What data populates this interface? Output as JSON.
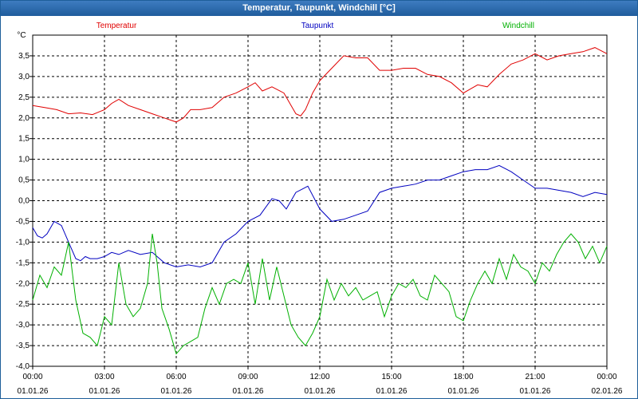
{
  "window": {
    "title": "Temperatur, Taupunkt, Windchill [°C]"
  },
  "chart_data": {
    "type": "line",
    "title": "Temperatur, Taupunkt, Windchill [°C]",
    "ylabel": "°C",
    "xlabel": "",
    "ylim": [
      -4.0,
      4.0
    ],
    "xlim": [
      0,
      24
    ],
    "yticks": [
      -4.0,
      -3.5,
      -3.0,
      -2.5,
      -2.0,
      -1.5,
      -1.0,
      -0.5,
      0.0,
      0.5,
      1.0,
      1.5,
      2.0,
      2.5,
      3.0,
      3.5
    ],
    "ytick_labels": [
      "-4,0",
      "-3,5",
      "-3,0",
      "-2,5",
      "-2,0",
      "-1,5",
      "-1,0",
      "-0,5",
      "0,0",
      "0,5",
      "1,0",
      "1,5",
      "2,0",
      "2,5",
      "3,0",
      "3,5"
    ],
    "xticks": [
      0,
      3,
      6,
      9,
      12,
      15,
      18,
      21,
      24
    ],
    "xtick_time_labels": [
      "00:00",
      "03:00",
      "06:00",
      "09:00",
      "12:00",
      "15:00",
      "18:00",
      "21:00",
      "00:00"
    ],
    "xtick_date_labels": [
      "01.01.26",
      "01.01.26",
      "01.01.26",
      "01.01.26",
      "01.01.26",
      "01.01.26",
      "01.01.26",
      "01.01.26",
      "02.01.26"
    ],
    "grid": true,
    "legend": "top",
    "series": [
      {
        "name": "Temperatur",
        "color": "#e00000",
        "x": [
          0,
          0.5,
          1,
          1.5,
          2,
          2.5,
          3,
          3.3,
          3.6,
          4,
          4.5,
          5,
          5.5,
          6,
          6.3,
          6.6,
          7,
          7.5,
          8,
          8.5,
          9,
          9.3,
          9.6,
          10,
          10.5,
          10.8,
          11,
          11.2,
          11.4,
          11.7,
          12,
          12.5,
          13,
          13.5,
          14,
          14.5,
          15,
          15.5,
          16,
          16.5,
          17,
          17.5,
          18,
          18.3,
          18.6,
          19,
          19.5,
          20,
          20.5,
          21,
          21.5,
          22,
          22.5,
          23,
          23.5,
          24
        ],
        "values": [
          2.3,
          2.25,
          2.2,
          2.1,
          2.12,
          2.08,
          2.2,
          2.35,
          2.45,
          2.3,
          2.2,
          2.1,
          2.0,
          1.9,
          2.0,
          2.2,
          2.2,
          2.25,
          2.5,
          2.6,
          2.75,
          2.85,
          2.65,
          2.75,
          2.6,
          2.3,
          2.1,
          2.05,
          2.2,
          2.6,
          2.9,
          3.2,
          3.5,
          3.45,
          3.45,
          3.15,
          3.15,
          3.2,
          3.2,
          3.05,
          3.0,
          2.85,
          2.6,
          2.7,
          2.8,
          2.75,
          3.05,
          3.3,
          3.4,
          3.55,
          3.4,
          3.5,
          3.55,
          3.6,
          3.7,
          3.55
        ]
      },
      {
        "name": "Taupunkt",
        "color": "#0000c0",
        "x": [
          0,
          0.2,
          0.4,
          0.6,
          0.9,
          1.2,
          1.5,
          1.8,
          2.0,
          2.2,
          2.4,
          2.7,
          3.0,
          3.3,
          3.6,
          4,
          4.5,
          5,
          5.5,
          6,
          6.5,
          7,
          7.5,
          8,
          8.5,
          9,
          9.5,
          10,
          10.3,
          10.6,
          11,
          11.5,
          12,
          12.5,
          13,
          13.5,
          14,
          14.5,
          15,
          15.5,
          16,
          16.5,
          17,
          17.5,
          18,
          18.5,
          19,
          19.5,
          20,
          20.5,
          21,
          21.5,
          22,
          22.5,
          23,
          23.5,
          24
        ],
        "values": [
          -0.65,
          -0.85,
          -0.9,
          -0.8,
          -0.5,
          -0.6,
          -1.0,
          -1.4,
          -1.45,
          -1.35,
          -1.4,
          -1.4,
          -1.35,
          -1.25,
          -1.3,
          -1.2,
          -1.3,
          -1.25,
          -1.5,
          -1.6,
          -1.55,
          -1.6,
          -1.5,
          -1.0,
          -0.8,
          -0.5,
          -0.35,
          0.05,
          0.0,
          -0.2,
          0.2,
          0.35,
          -0.2,
          -0.5,
          -0.45,
          -0.35,
          -0.25,
          0.2,
          0.3,
          0.35,
          0.4,
          0.5,
          0.5,
          0.6,
          0.7,
          0.75,
          0.75,
          0.85,
          0.7,
          0.5,
          0.3,
          0.3,
          0.25,
          0.2,
          0.1,
          0.2,
          0.15
        ]
      },
      {
        "name": "Windchill",
        "color": "#00b000",
        "x": [
          0,
          0.3,
          0.6,
          0.9,
          1.2,
          1.5,
          1.8,
          2.1,
          2.4,
          2.7,
          3.0,
          3.3,
          3.6,
          3.9,
          4.2,
          4.5,
          4.8,
          5.0,
          5.2,
          5.4,
          5.7,
          6.0,
          6.3,
          6.6,
          6.9,
          7.2,
          7.5,
          7.8,
          8.1,
          8.4,
          8.7,
          9.0,
          9.3,
          9.6,
          9.9,
          10.2,
          10.5,
          10.8,
          11.1,
          11.4,
          11.7,
          12.0,
          12.3,
          12.6,
          12.9,
          13.2,
          13.5,
          13.8,
          14.1,
          14.4,
          14.7,
          15.0,
          15.3,
          15.6,
          15.9,
          16.2,
          16.5,
          16.8,
          17.1,
          17.4,
          17.7,
          18.0,
          18.3,
          18.6,
          18.9,
          19.2,
          19.5,
          19.8,
          20.1,
          20.4,
          20.7,
          21.0,
          21.3,
          21.6,
          21.9,
          22.2,
          22.5,
          22.8,
          23.1,
          23.4,
          23.7,
          24.0
        ],
        "values": [
          -2.4,
          -1.8,
          -2.1,
          -1.6,
          -1.8,
          -1.0,
          -2.4,
          -3.2,
          -3.3,
          -3.5,
          -2.8,
          -3.0,
          -1.5,
          -2.5,
          -2.8,
          -2.6,
          -2.0,
          -0.8,
          -1.5,
          -2.6,
          -3.1,
          -3.7,
          -3.5,
          -3.4,
          -3.3,
          -2.6,
          -2.1,
          -2.5,
          -2.0,
          -1.9,
          -2.0,
          -1.5,
          -2.5,
          -1.4,
          -2.4,
          -1.6,
          -2.3,
          -3.0,
          -3.3,
          -3.5,
          -3.2,
          -2.8,
          -1.9,
          -2.4,
          -2.0,
          -2.3,
          -2.1,
          -2.4,
          -2.3,
          -2.2,
          -2.8,
          -2.3,
          -2.0,
          -2.1,
          -1.9,
          -2.3,
          -2.4,
          -1.8,
          -2.0,
          -2.2,
          -2.8,
          -2.9,
          -2.4,
          -2.0,
          -1.7,
          -2.0,
          -1.4,
          -1.9,
          -1.3,
          -1.6,
          -1.7,
          -2.0,
          -1.5,
          -1.7,
          -1.3,
          -1.0,
          -0.8,
          -1.0,
          -1.4,
          -1.1,
          -1.5,
          -1.1
        ]
      }
    ]
  }
}
